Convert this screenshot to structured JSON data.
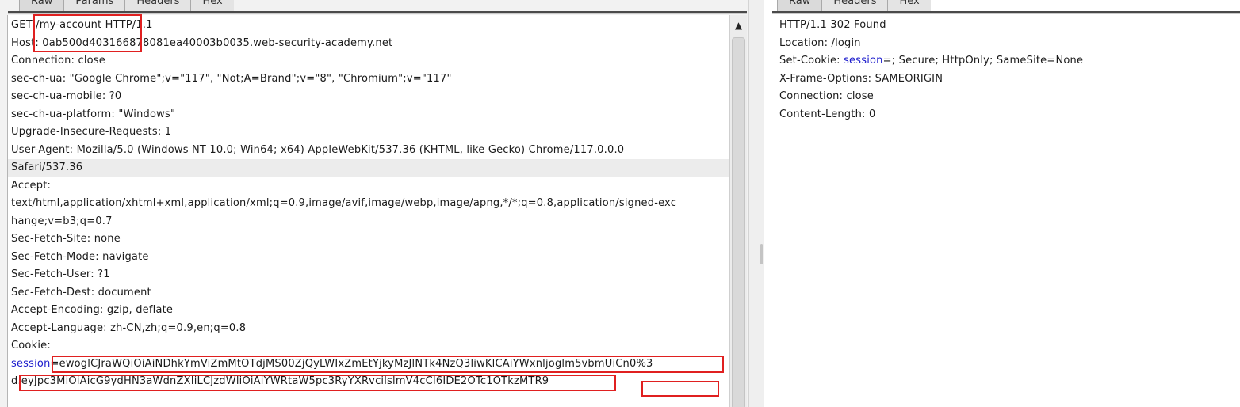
{
  "request_tabs": [
    "Raw",
    "Params",
    "Headers",
    "Hex"
  ],
  "response_tabs": [
    "Raw",
    "Headers",
    "Hex"
  ],
  "request": {
    "lines": [
      {
        "text": "GET /my-account HTTP/1.1"
      },
      {
        "text": "Host: 0ab500d403166878081ea40003b0035.web-security-academy.net"
      },
      {
        "text": "Connection: close"
      },
      {
        "text": "sec-ch-ua: \"Google Chrome\";v=\"117\", \"Not;A=Brand\";v=\"8\", \"Chromium\";v=\"117\""
      },
      {
        "text": "sec-ch-ua-mobile: ?0"
      },
      {
        "text": "sec-ch-ua-platform: \"Windows\""
      },
      {
        "text": "Upgrade-Insecure-Requests: 1"
      },
      {
        "text": "User-Agent: Mozilla/5.0 (Windows NT 10.0; Win64; x64) AppleWebKit/537.36 (KHTML, like Gecko) Chrome/117.0.0.0"
      },
      {
        "text": "Safari/537.36"
      },
      {
        "text": "Accept:"
      },
      {
        "text": "text/html,application/xhtml+xml,application/xml;q=0.9,image/avif,image/webp,image/apng,*/*;q=0.8,application/signed-exc"
      },
      {
        "text": "hange;v=b3;q=0.7"
      },
      {
        "text": "Sec-Fetch-Site: none"
      },
      {
        "text": "Sec-Fetch-Mode: navigate"
      },
      {
        "text": "Sec-Fetch-User: ?1"
      },
      {
        "text": "Sec-Fetch-Dest: document"
      },
      {
        "text": "Accept-Encoding: gzip, deflate"
      },
      {
        "text": "Accept-Language: zh-CN,zh;q=0.9,en;q=0.8"
      },
      {
        "text": "Cookie:"
      },
      {
        "key": "session",
        "text": "=ewoglCJraWQiOiAiNDhkYmViZmMtOTdjMS00ZjQyLWIxZmEtYjkyMzJlNTk4NzQ3liwKlCAiYWxnljoglm5vbmUiCn0%3"
      },
      {
        "text": "d.eyJpc3MiOiAicG9ydHN3aWdnZXIiLCJzdWliOiAiYWRtaW5pc3RyYXRvcilslmV4cCI6IDE2OTc1OTkzMTR9"
      }
    ]
  },
  "response": {
    "lines": [
      {
        "text": "HTTP/1.1 302 Found"
      },
      {
        "text": "Location: /login"
      },
      {
        "prefix": "Set-Cookie: ",
        "key": "session",
        "text": "=; Secure; HttpOnly; SameSite=None"
      },
      {
        "text": "X-Frame-Options: SAMEORIGIN"
      },
      {
        "text": "Connection: close"
      },
      {
        "text": "Content-Length: 0"
      }
    ]
  },
  "scrollbar": {
    "up_arrow": "▲"
  },
  "colors": {
    "annotation": "#e02020",
    "keyword": "#1a1acc"
  }
}
